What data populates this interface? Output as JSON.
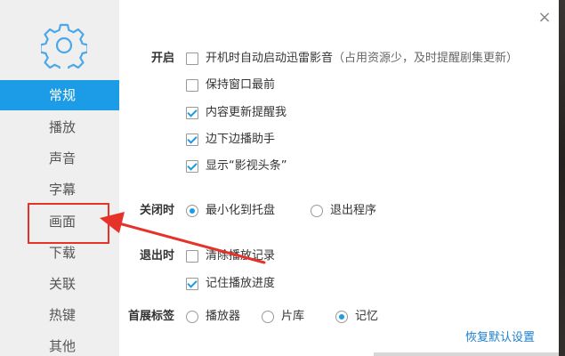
{
  "sidebar": {
    "items": [
      {
        "label": "常规",
        "active": true
      },
      {
        "label": "播放"
      },
      {
        "label": "声音"
      },
      {
        "label": "字幕"
      },
      {
        "label": "画面"
      },
      {
        "label": "下载"
      },
      {
        "label": "关联"
      },
      {
        "label": "热键"
      },
      {
        "label": "其他"
      }
    ]
  },
  "close_glyph": "×",
  "sections": {
    "startup": {
      "label": "开启",
      "options": [
        {
          "label": "开机时自动启动迅雷影音",
          "hint": "（占用资源少，及时提醒剧集更新）",
          "checked": false
        },
        {
          "label": "保持窗口最前",
          "checked": false
        },
        {
          "label": "内容更新提醒我",
          "checked": true
        },
        {
          "label": "边下边播助手",
          "checked": true
        },
        {
          "label": "显示“影视头条”",
          "checked": true
        }
      ]
    },
    "on_close": {
      "label": "关闭时",
      "options": [
        {
          "label": "最小化到托盘",
          "selected": true
        },
        {
          "label": "退出程序",
          "selected": false
        }
      ]
    },
    "on_exit": {
      "label": "退出时",
      "options": [
        {
          "label": "清除播放记录",
          "checked": false
        },
        {
          "label": "记住播放进度",
          "checked": true
        }
      ]
    },
    "home_tab": {
      "label": "首展标签",
      "options": [
        {
          "label": "播放器",
          "selected": false
        },
        {
          "label": "片库",
          "selected": false
        },
        {
          "label": "记忆",
          "selected": true
        }
      ]
    }
  },
  "restore_defaults": "恢复默认设置",
  "colors": {
    "accent": "#1c9be6",
    "annotation": "#e6332a",
    "sidebar_bg": "#efefef"
  }
}
